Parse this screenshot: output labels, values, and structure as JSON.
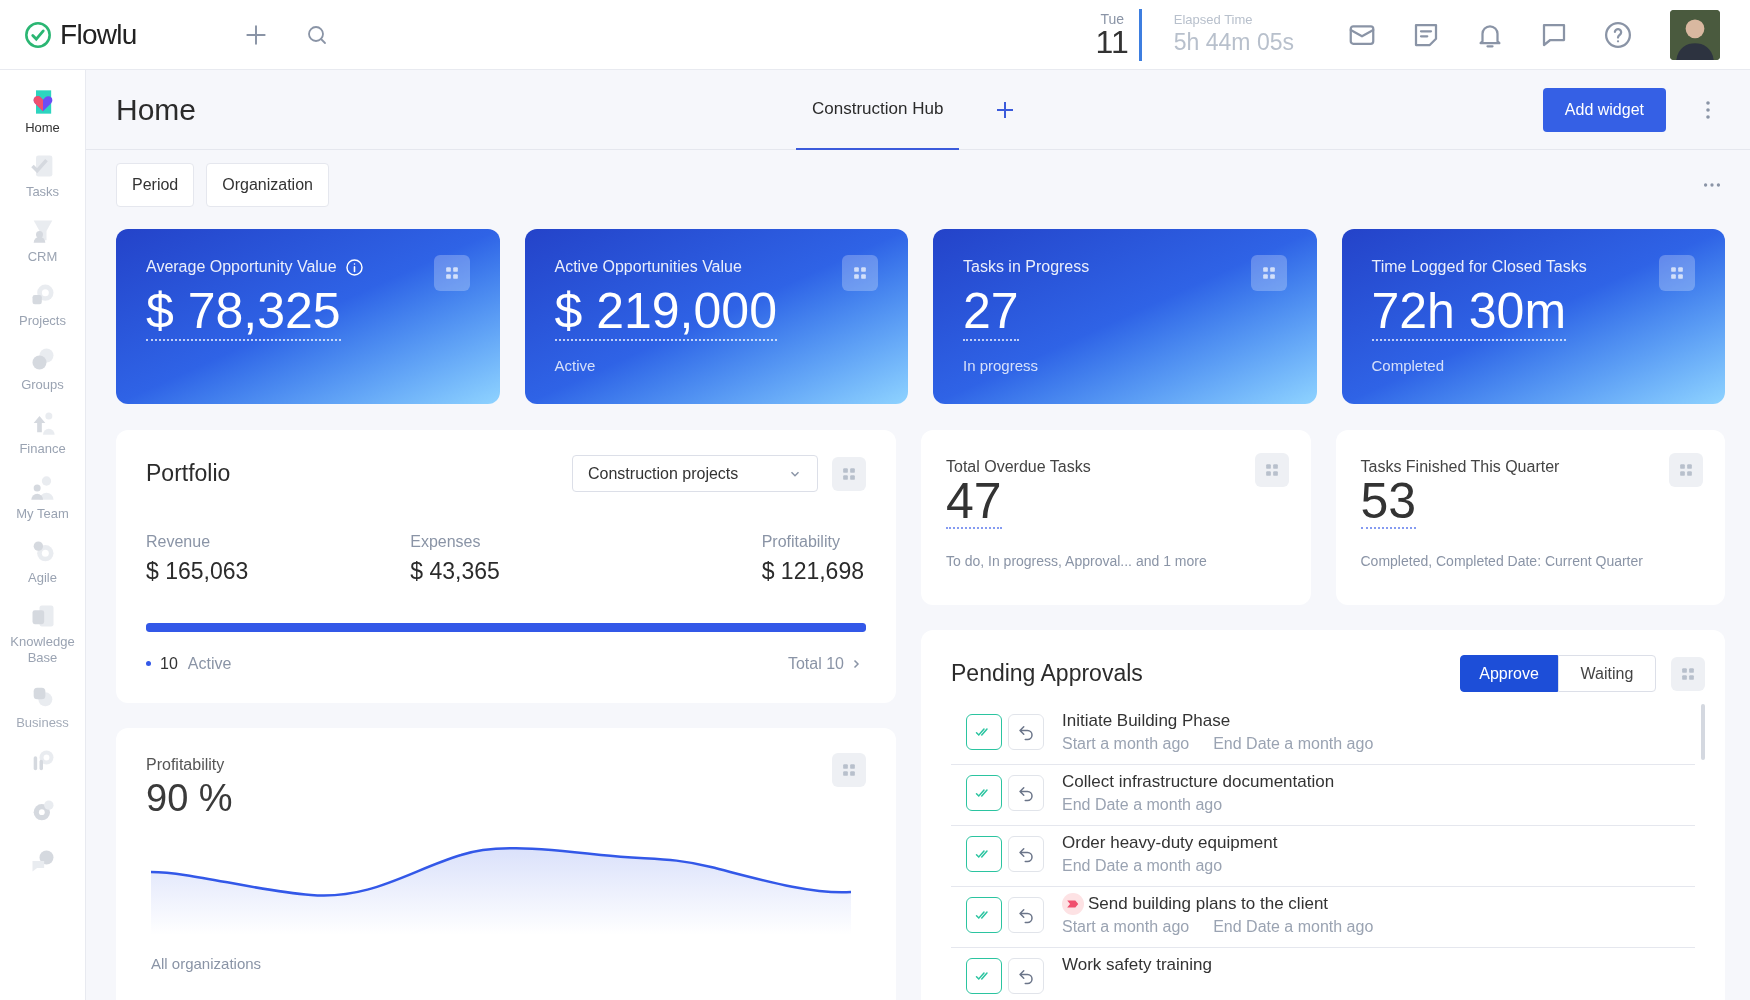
{
  "topbar": {
    "logo": "Flowlu",
    "date": {
      "weekday": "Tue",
      "day": "11"
    },
    "elapsed": {
      "label": "Elapsed Time",
      "value": "5h 44m 05s"
    }
  },
  "sidebar": {
    "items": [
      {
        "kind": "home",
        "label": "Home",
        "selected": true
      },
      {
        "kind": "tasks",
        "label": "Tasks",
        "selected": false
      },
      {
        "kind": "crm",
        "label": "CRM",
        "selected": false
      },
      {
        "kind": "projects",
        "label": "Projects",
        "selected": false
      },
      {
        "kind": "groups",
        "label": "Groups",
        "selected": false
      },
      {
        "kind": "finance",
        "label": "Finance",
        "selected": false
      },
      {
        "kind": "team",
        "label": "My Team",
        "selected": false
      },
      {
        "kind": "agile",
        "label": "Agile",
        "selected": false
      },
      {
        "kind": "knowledge",
        "label": "Knowledge Base",
        "selected": false
      },
      {
        "kind": "business",
        "label": "Business",
        "selected": false
      },
      {
        "kind": "planner",
        "selected": false
      },
      {
        "kind": "settings",
        "selected": false
      },
      {
        "kind": "more",
        "selected": false
      }
    ]
  },
  "header": {
    "title": "Home",
    "tabs": [
      {
        "label": "Construction Hub",
        "selected": true
      }
    ],
    "add_widget": "Add widget"
  },
  "filters": [
    "Period",
    "Organization"
  ],
  "kpis": [
    {
      "title": "Average Opportunity Value",
      "info": true,
      "value": "$ 78,325"
    },
    {
      "title": "Active Opportunities Value",
      "info": false,
      "value": "$ 219,000",
      "subtitle": "Active"
    },
    {
      "title": "Tasks in Progress",
      "info": false,
      "value": "27",
      "subtitle": "In progress"
    },
    {
      "title": "Time Logged for Closed Tasks",
      "info": false,
      "value": "72h 30m",
      "subtitle": "Completed"
    }
  ],
  "portfolio": {
    "title": "Portfolio",
    "dropdown": "Construction projects",
    "metrics": [
      {
        "label": "Revenue",
        "value": "$ 165,063"
      },
      {
        "label": "Expenses",
        "value": "$ 43,365"
      },
      {
        "label": "Profitability",
        "value": "$ 121,698"
      }
    ],
    "progress": {
      "level": 1
    },
    "active_count": "10",
    "active_label": "Active",
    "total": "Total 10"
  },
  "stats": [
    {
      "title": "Total Overdue Tasks",
      "value": "47",
      "note": "To do, In progress, Approval... and 1 more"
    },
    {
      "title": "Tasks Finished This Quarter",
      "value": "53",
      "note": "Completed, Completed Date: Current Quarter"
    }
  ],
  "profitability": {
    "title": "Profitability",
    "value": "90 %",
    "footer": "All organizations"
  },
  "approvals": {
    "title": "Pending Approvals",
    "toggle": [
      {
        "label": "Approve",
        "selected": true
      },
      {
        "label": "Waiting",
        "selected": false
      }
    ],
    "items": [
      {
        "title": "Initiate Building Phase",
        "flag": false,
        "start": "Start a month ago",
        "end": "End Date a month ago"
      },
      {
        "title": "Collect infrastructure documentation",
        "flag": false,
        "end": "End Date a month ago"
      },
      {
        "title": "Order heavy-duty equipment",
        "flag": false,
        "end": "End Date a month ago"
      },
      {
        "title": "Send building plans to the client",
        "flag": true,
        "start": "Start a month ago",
        "end": "End Date a month ago"
      },
      {
        "title": "Work safety training",
        "flag": false
      }
    ]
  }
}
